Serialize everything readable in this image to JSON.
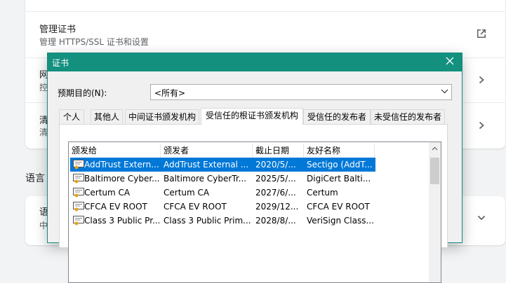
{
  "settings": {
    "cert_mgmt_title": "管理证书",
    "cert_mgmt_sub": "管理 HTTPS/SSL 证书和设置",
    "row2_title": "网",
    "row2_sub": "控",
    "row3_title": "清",
    "row3_sub": "清",
    "language_section": "语言",
    "lang_title": "语",
    "lang_sub": "中"
  },
  "dialog": {
    "title": "证书",
    "purpose_label": "预期目的(N):",
    "purpose_value": "<所有>",
    "tabs": [
      "个人",
      "其他人",
      "中间证书颁发机构",
      "受信任的根证书颁发机构",
      "受信任的发布者",
      "未受信任的发布者"
    ],
    "active_tab": 3,
    "columns": [
      "颁发给",
      "颁发者",
      "截止日期",
      "友好名称"
    ],
    "rows": [
      {
        "issued_to": "AddTrust Extern...",
        "issuer": "AddTrust External ...",
        "expires": "2020/5/...",
        "friendly": "Sectigo (AddT...",
        "selected": true
      },
      {
        "issued_to": "Baltimore Cyber...",
        "issuer": "Baltimore CyberTr...",
        "expires": "2025/5/...",
        "friendly": "DigiCert Balti..."
      },
      {
        "issued_to": "Certum CA",
        "issuer": "Certum CA",
        "expires": "2027/6/...",
        "friendly": "Certum"
      },
      {
        "issued_to": "CFCA EV ROOT",
        "issuer": "CFCA EV ROOT",
        "expires": "2029/12...",
        "friendly": "CFCA EV ROOT"
      },
      {
        "issued_to": "Class 3 Public Pr...",
        "issuer": "Class 3 Public Prim...",
        "expires": "2028/8/...",
        "friendly": "VeriSign Class..."
      }
    ]
  },
  "colors": {
    "titlebar": "#14907f",
    "selection": "#0078d7"
  },
  "icons": [
    "external-link-icon",
    "chevron-right-icon",
    "chevron-down-icon",
    "close-icon",
    "certificate-icon",
    "dropdown-arrow-icon"
  ]
}
